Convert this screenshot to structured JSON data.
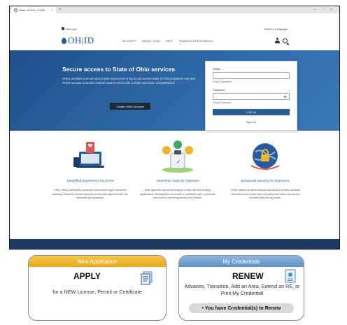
{
  "browser": {
    "tab_title": "State of Ohio | OH|ID",
    "tab_close": "×",
    "new_tab": "+",
    "window_controls": "– ▫ ×"
  },
  "topbar": {
    "gov_link": "Ohio.gov",
    "language": "Select a Language"
  },
  "nav": {
    "logo_text": "OH|ID",
    "links": [
      "SECURITY",
      "ABOUT OH|ID",
      "HELP",
      "TRAINING & RESOURCES"
    ]
  },
  "hero": {
    "title": "Secure access to State of Ohio services",
    "text": "OH|ID provides a secure and private experience to log in and access State of Ohio programs. Use one OH|ID account to access multiple state services with a single username and password.",
    "button": "Create OH|ID Account"
  },
  "login": {
    "username_label": "OH|ID",
    "username_hint": "Forgot Username",
    "password_label": "Password",
    "password_hint": "Forgot Password",
    "eye": "👁",
    "login_button": "LOG IN",
    "signup": "Sign Up"
  },
  "features": [
    {
      "title": "Simplified Experience for Users",
      "text": "OH|ID offers a simplified, convenient and secure login experience allowing Ohioans to access services across state agencies with one username and password."
    },
    {
      "title": "Seamless Tools for Agencies",
      "text": "State agencies can easily integrate OH|ID into their existing applications, allowing them to provide a consistent login experience and focus on delivering services to Ohioans."
    },
    {
      "title": "Enhanced Security for Everyone",
      "text": "OH|ID utilizes the latest industry standards to protect personal information and ensure that only authorized users can access sensitive data and accounts."
    }
  ],
  "cards": {
    "apply": {
      "header": "New Application",
      "title": "APPLY",
      "desc": "for a NEW License, Permit or Certificate"
    },
    "renew": {
      "header": "My Credentials",
      "title": "RENEW",
      "desc": "Advance, Transition, Add an Area, Extend an RE, or Print My Credential",
      "pill": "• You have Credential(s) to Renew"
    }
  },
  "colors": {
    "brand_blue": "#2a5a9e",
    "apply_header": "#f0b42e",
    "renew_header": "#6f9bcd"
  }
}
